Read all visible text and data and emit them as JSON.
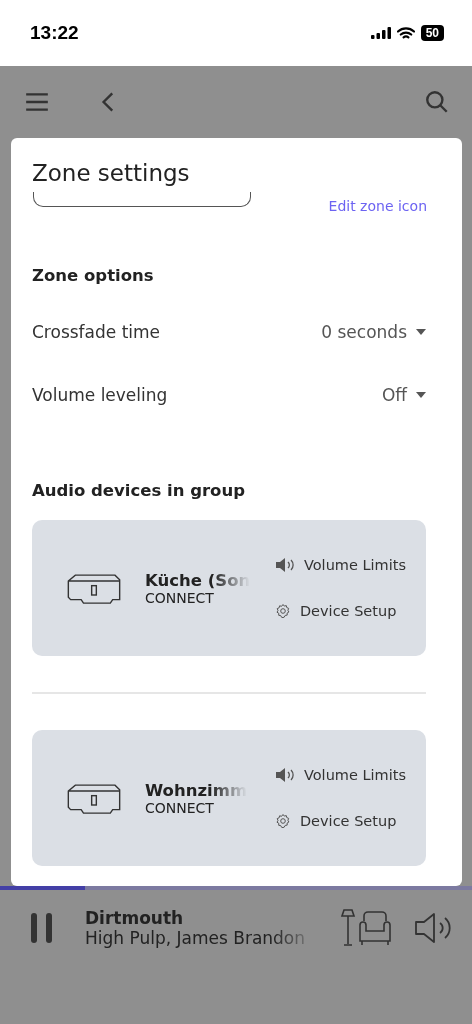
{
  "status_bar": {
    "time": "13:22",
    "battery": "50"
  },
  "dialog": {
    "title": "Zone settings",
    "name_field": {
      "kind": "field"
    },
    "edit_icon_link": "Edit zone icon",
    "options_heading": "Zone options",
    "options": [
      {
        "label": "Crossfade time",
        "value": "0 seconds"
      },
      {
        "label": "Volume leveling",
        "value": "Off"
      }
    ],
    "devices_heading": "Audio devices in group",
    "devices": [
      {
        "name": "Küche (Son",
        "model": "CONNECT",
        "actions": [
          {
            "kind": "volume",
            "label": "Volume Limits"
          },
          {
            "kind": "setup",
            "label": "Device Setup"
          }
        ]
      },
      {
        "name": "Wohnzimm",
        "model": "CONNECT",
        "actions": [
          {
            "kind": "volume",
            "label": "Volume Limits"
          },
          {
            "kind": "setup",
            "label": "Device Setup"
          }
        ]
      }
    ]
  },
  "player": {
    "level": 0.18,
    "title": "Dirtmouth",
    "artist": "High Pulp, James Brandon",
    "playing": true
  }
}
